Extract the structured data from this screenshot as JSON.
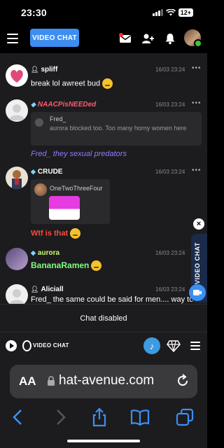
{
  "status": {
    "time": "23:30",
    "battery": "12+"
  },
  "header": {
    "video_chat_button": "VIDEO CHAT"
  },
  "messages": [
    {
      "name": "spliff",
      "time": "16/03 23:24",
      "text": "break lol awreet bud",
      "name_color": "#ffffff",
      "text_color": "#ffffff"
    },
    {
      "name": "NAACPisNEEDed",
      "time": "16/03 23:24",
      "quote_name": "Fred_",
      "quote_text": "aurora blocked too. Too many horny women here",
      "text": "Fred_ they sexual predators",
      "name_color": "#ff5a6e",
      "text_color": "#8f7cff"
    },
    {
      "name": "CRUDE",
      "time": "16/03 23:24",
      "pm_name": "OneTwoThreeFour",
      "text": "Wtf is that",
      "name_color": "#ffffff",
      "text_color": "#ff4a3a"
    },
    {
      "name": "aurora",
      "time": "16/03 23:24",
      "text": "BananaRamen",
      "name_color": "#c9ff66",
      "text_color": "#7fff7f"
    },
    {
      "name": "Aliciall",
      "time": "16/03 23:24",
      "text": "Fred_ the same could be said for men.... way to",
      "name_color": "#ffffff",
      "text_color": "#ffffff"
    }
  ],
  "side_tab": {
    "label": "VIDEO CHAT",
    "close": "×"
  },
  "chat_disabled": "Chat disabled",
  "toolbar": {
    "video_chat_label": "VIDEO CHAT",
    "music_glyph": "♪"
  },
  "browser": {
    "aa": "AA",
    "url": "hat-avenue.com"
  },
  "icons": [
    "menu-icon",
    "mail-icon",
    "add-user-icon",
    "bell-icon",
    "avatar",
    "play-icon",
    "camera-icon",
    "music-icon",
    "gem-icon",
    "lock-icon",
    "reload-icon",
    "back-icon",
    "forward-icon",
    "share-icon",
    "bookmarks-icon",
    "tabs-icon"
  ]
}
